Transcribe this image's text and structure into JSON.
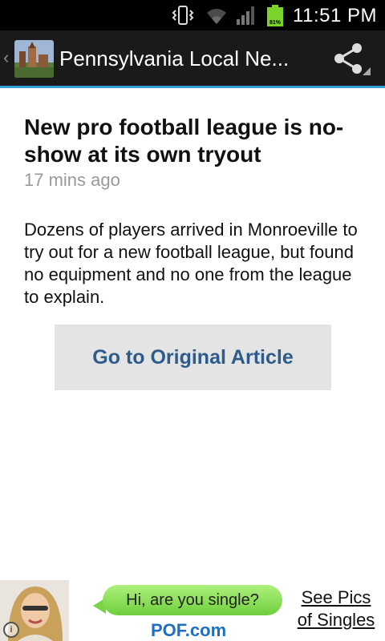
{
  "status_bar": {
    "time": "11:51 PM",
    "battery_percent": "81%",
    "icons": [
      "vibrate-icon",
      "wifi-icon",
      "signal-icon",
      "battery-icon"
    ]
  },
  "action_bar": {
    "title": "Pennsylvania Local Ne...",
    "icon": "app-icon",
    "share_icon": "share-icon"
  },
  "article": {
    "headline": "New pro football league is no-show at its own tryout",
    "timestamp": "17 mins ago",
    "body": "Dozens of players arrived in Monroeville to try out for a new football league, but found no equipment and no one from the league to explain.",
    "button_label": "Go to Original Article"
  },
  "ad": {
    "bubble_text": "Hi, are you single?",
    "site": "POF.com",
    "link_line1": "See Pics",
    "link_line2": "of Singles"
  },
  "colors": {
    "action_bar_bg": "#1a1a1a",
    "accent_line": "#33a0d8",
    "button_text": "#2d5b8c",
    "button_bg": "#e4e4e4"
  }
}
